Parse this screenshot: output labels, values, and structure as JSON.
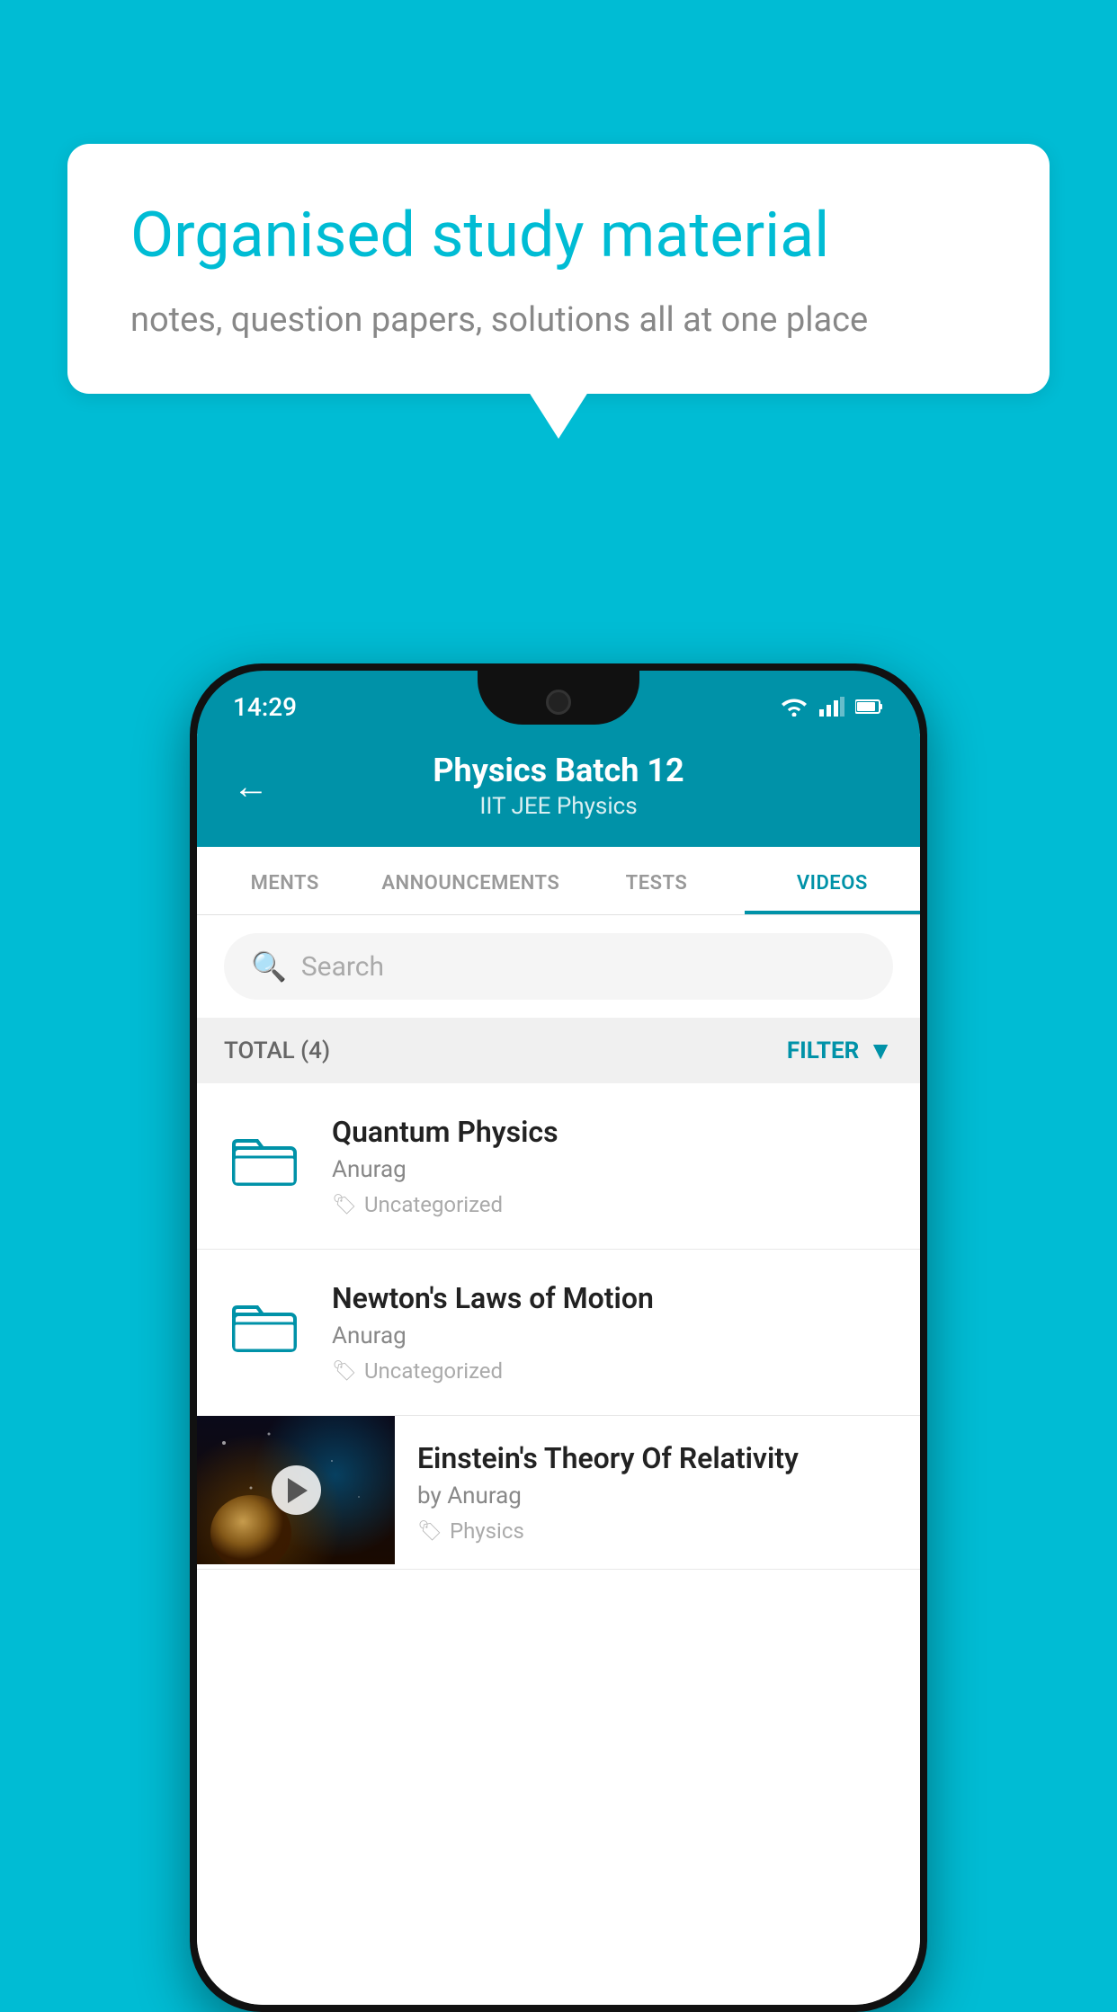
{
  "background_color": "#00bcd4",
  "speech_bubble": {
    "title": "Organised study material",
    "subtitle": "notes, question papers, solutions all at one place"
  },
  "phone": {
    "status_bar": {
      "time": "14:29",
      "icons": [
        "wifi",
        "signal",
        "battery"
      ]
    },
    "header": {
      "back_label": "←",
      "title": "Physics Batch 12",
      "subtitle": "IIT JEE   Physics"
    },
    "tabs": [
      {
        "label": "MENTS",
        "active": false
      },
      {
        "label": "ANNOUNCEMENTS",
        "active": false
      },
      {
        "label": "TESTS",
        "active": false
      },
      {
        "label": "VIDEOS",
        "active": true
      }
    ],
    "search": {
      "placeholder": "Search"
    },
    "filter_bar": {
      "total_label": "TOTAL (4)",
      "filter_label": "FILTER"
    },
    "videos": [
      {
        "type": "folder",
        "title": "Quantum Physics",
        "author": "Anurag",
        "tag": "Uncategorized"
      },
      {
        "type": "folder",
        "title": "Newton's Laws of Motion",
        "author": "Anurag",
        "tag": "Uncategorized"
      },
      {
        "type": "video",
        "title": "Einstein's Theory Of Relativity",
        "author": "by Anurag",
        "tag": "Physics"
      }
    ]
  }
}
